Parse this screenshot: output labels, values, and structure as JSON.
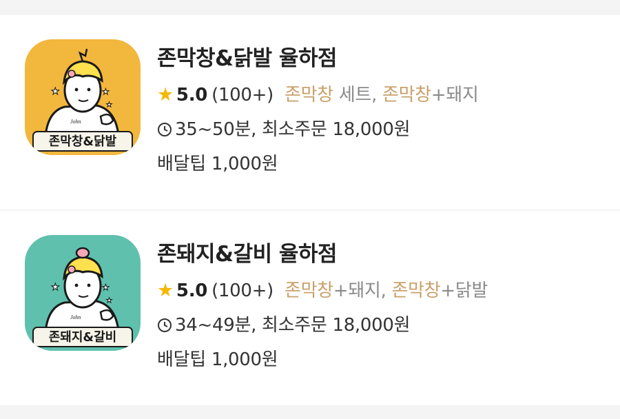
{
  "stores": [
    {
      "name": "존막창&닭발 율하점",
      "logo_text": "존막창&닭발",
      "logo_signature": "John",
      "logo_bg": "#f2b73d",
      "logo_banner": "#f7f4e9",
      "rating": "5.0",
      "review_count": "(100+)",
      "menu_parts": [
        {
          "text": "존막창",
          "highlight": true
        },
        {
          "text": " 세트, ",
          "highlight": false
        },
        {
          "text": "존막창",
          "highlight": true
        },
        {
          "text": "+돼지",
          "highlight": false
        }
      ],
      "delivery_time": "35~50분, 최소주문 18,000원",
      "delivery_tip": "배달팁 1,000원"
    },
    {
      "name": "존돼지&갈비 율하점",
      "logo_text": "존돼지&갈비",
      "logo_signature": "John",
      "logo_bg": "#5fc0ad",
      "logo_banner": "#f7f4e9",
      "rating": "5.0",
      "review_count": "(100+)",
      "menu_parts": [
        {
          "text": "존막창",
          "highlight": true
        },
        {
          "text": "+돼지, ",
          "highlight": false
        },
        {
          "text": "존막창",
          "highlight": true
        },
        {
          "text": "+닭발",
          "highlight": false
        }
      ],
      "delivery_time": "34~49분, 최소주문 18,000원",
      "delivery_tip": "배달팁 1,000원"
    }
  ],
  "icons": {
    "rating": "star-icon",
    "time": "clock-icon"
  },
  "colors": {
    "star": "#f5b800",
    "menu_highlight": "#c9a06a",
    "menu_text": "#8a8a8a"
  }
}
